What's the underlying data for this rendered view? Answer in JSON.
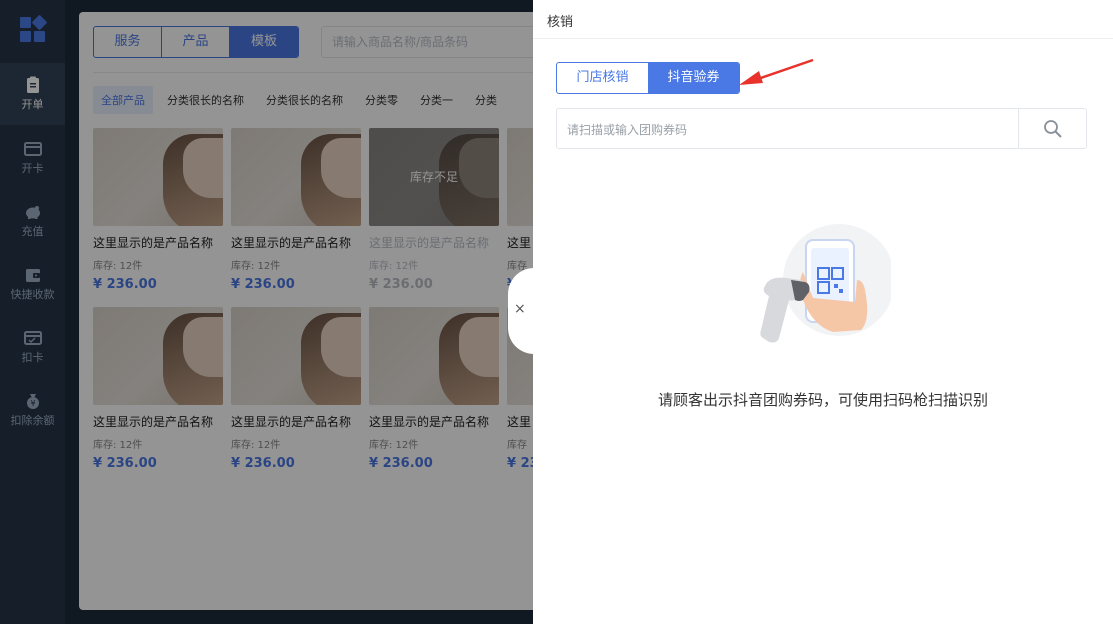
{
  "sidebar": {
    "items": [
      {
        "label": "开单",
        "icon": "clipboard-icon",
        "active": true
      },
      {
        "label": "开卡",
        "icon": "card-icon",
        "active": false
      },
      {
        "label": "充值",
        "icon": "piggy-bank-icon",
        "active": false
      },
      {
        "label": "快捷收款",
        "icon": "wallet-icon",
        "active": false
      },
      {
        "label": "扣卡",
        "icon": "card-deduct-icon",
        "active": false
      },
      {
        "label": "扣除余额",
        "icon": "money-bag-icon",
        "active": false
      }
    ]
  },
  "main": {
    "segments": [
      "服务",
      "产品",
      "模板"
    ],
    "search_placeholder": "请输入商品名称/商品条码",
    "categories": [
      "全部产品",
      "分类很长的名称",
      "分类很长的名称",
      "分类零",
      "分类一",
      "分类"
    ],
    "products": [
      {
        "name": "这里显示的是产品名称",
        "stock": "库存: 12件",
        "price": "¥ 236.00"
      },
      {
        "name": "这里显示的是产品名称",
        "stock": "库存: 12件",
        "price": "¥ 236.00"
      },
      {
        "name": "这里显示的是产品名称",
        "stock": "库存: 12件",
        "price": "¥ 236.00",
        "badge": "库存不足"
      },
      {
        "name": "这里",
        "stock": "库存",
        "price": "¥ 2"
      },
      {
        "name": "这里显示的是产品名称",
        "stock": "库存: 12件",
        "price": "¥ 236.00"
      },
      {
        "name": "这里显示的是产品名称",
        "stock": "库存: 12件",
        "price": "¥ 236.00"
      },
      {
        "name": "这里显示的是产品名称",
        "stock": "库存: 12件",
        "price": "¥ 236.00"
      },
      {
        "name": "这里",
        "stock": "库存",
        "price": "¥ 23"
      }
    ]
  },
  "drawer": {
    "title": "核销",
    "tabs": [
      "门店核销",
      "抖音验券"
    ],
    "active_tab": "抖音验券",
    "input_placeholder": "请扫描或输入团购券码",
    "hint": "请顾客出示抖音团购券码，可使用扫码枪扫描识别",
    "close_glyph": "×"
  },
  "colors": {
    "accent": "#4a78e4",
    "sidebar": "#253548",
    "arrow": "#e8322b"
  }
}
